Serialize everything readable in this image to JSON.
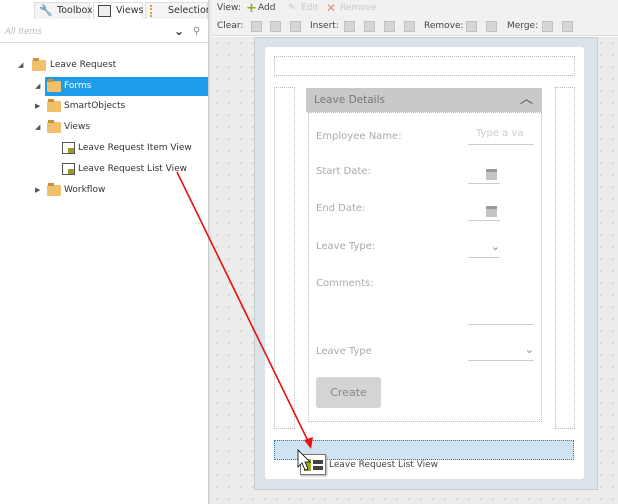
{
  "panel": {
    "tabs": [
      {
        "label": "Toolbox",
        "icon": "wrench-icon"
      },
      {
        "label": "Views",
        "icon": "view-icon"
      },
      {
        "label": "Selection",
        "icon": "selection-icon"
      }
    ],
    "search_placeholder": "All Items",
    "tree": {
      "root": "Leave Request",
      "items": [
        {
          "label": "Forms",
          "selected": true
        },
        {
          "label": "SmartObjects"
        },
        {
          "label": "Views"
        },
        {
          "label": "Leave Request Item View"
        },
        {
          "label": "Leave Request List View"
        },
        {
          "label": "Workflow"
        }
      ]
    },
    "selection_color": "#1e9be9"
  },
  "toolbar": {
    "view_label": "View:",
    "add": "Add",
    "edit": "Edit",
    "remove": "Remove",
    "clear_label": "Clear:",
    "insert_label": "Insert:",
    "remove_label": "Remove:",
    "merge_label": "Merge:"
  },
  "form": {
    "section_title": "Leave Details",
    "fields": {
      "employee_name": "Employee Name:",
      "employee_placeholder": "Type a va",
      "start_date": "Start Date:",
      "end_date": "End Date:",
      "leave_type": "Leave Type:",
      "comments": "Comments:",
      "leave_type2": "Leave Type"
    },
    "create_button": "Create"
  },
  "drag": {
    "label": "Leave Request List View",
    "arrow_color": "#e81010",
    "drop_color": "#d0e3f3"
  }
}
